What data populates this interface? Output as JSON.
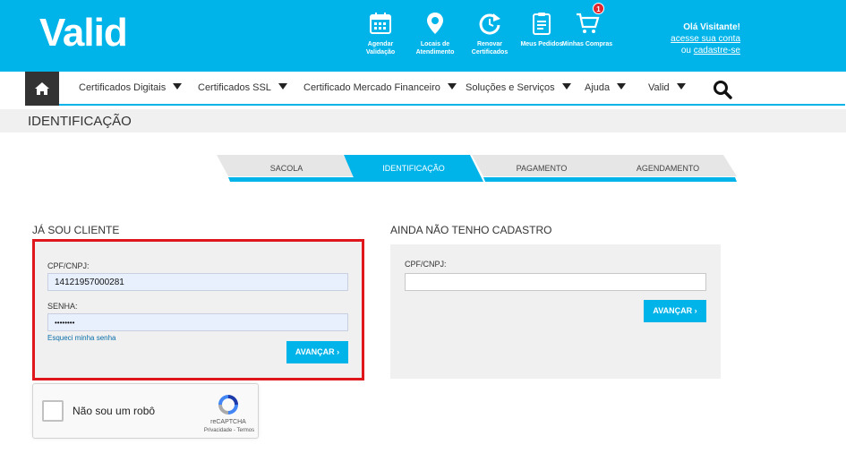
{
  "brand": {
    "logo": "Valid"
  },
  "quick_links": [
    {
      "label": "Agendar Validação",
      "icon": "calendar-icon"
    },
    {
      "label": "Locais de Atendimento",
      "icon": "map-pin-icon"
    },
    {
      "label": "Renovar Certificados",
      "icon": "renew-icon"
    },
    {
      "label": "Meus Pedidos",
      "icon": "orders-icon"
    },
    {
      "label": "Minhas Compras",
      "icon": "cart-icon",
      "badge": "1"
    }
  ],
  "visitor": {
    "greeting": "Olá Visitante!",
    "login_link": "acesse sua conta",
    "or_text": "ou",
    "signup_link": "cadastre-se"
  },
  "nav": {
    "items": [
      "Certificados Digitais",
      "Certificados SSL",
      "Certificado Mercado Financeiro",
      "Soluções e Serviços",
      "Ajuda",
      "Valid"
    ]
  },
  "page": {
    "title": "IDENTIFICAÇÃO"
  },
  "steps": [
    {
      "label": "SACOLA",
      "active": false
    },
    {
      "label": "IDENTIFICAÇÃO",
      "active": true
    },
    {
      "label": "PAGAMENTO",
      "active": false
    },
    {
      "label": "AGENDAMENTO",
      "active": false
    }
  ],
  "login": {
    "title": "JÁ SOU CLIENTE",
    "cpf_label": "CPF/CNPJ:",
    "cpf_value": "14121957000281",
    "password_label": "SENHA:",
    "password_value": "••••••••",
    "forgot_link": "Esqueci minha senha",
    "submit_label": "AVANÇAR ›"
  },
  "register": {
    "title": "AINDA NÃO TENHO CADASTRO",
    "cpf_label": "CPF/CNPJ:",
    "cpf_value": "",
    "submit_label": "AVANÇAR ›"
  },
  "recaptcha": {
    "label": "Não sou um robô",
    "brand": "reCAPTCHA",
    "links": "Privacidade - Termos"
  },
  "colors": {
    "accent": "#00b4ea",
    "highlight": "#e0161d",
    "dark": "#333333"
  }
}
